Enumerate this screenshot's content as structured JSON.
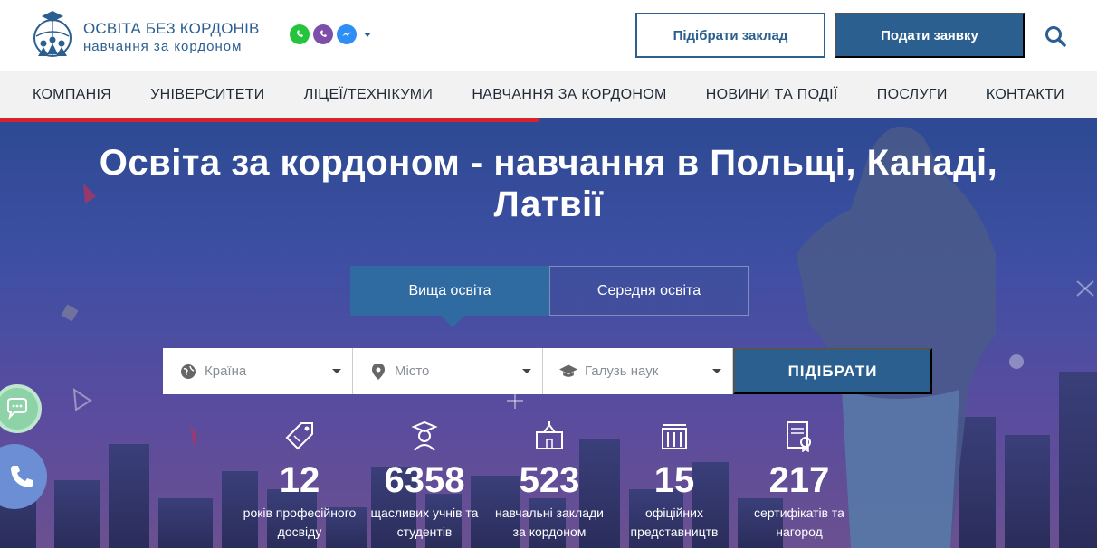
{
  "header": {
    "logo_title": "ОСВІТА БЕЗ КОРДОНІВ",
    "logo_subtitle": "навчання за кордоном",
    "btn_pick_school": "Підібрати заклад",
    "btn_apply": "Подати заявку"
  },
  "nav": {
    "items": [
      "КОМПАНІЯ",
      "УНІВЕРСИТЕТИ",
      "ЛІЦЕЇ/ТЕХНІКУМИ",
      "НАВЧАННЯ ЗА КОРДОНОМ",
      "НОВИНИ ТА ПОДІЇ",
      "ПОСЛУГИ",
      "КОНТАКТИ"
    ]
  },
  "hero": {
    "title_line1": "Освіта за кордоном - навчання в Польщі, Канаді,",
    "title_line2": "Латвії",
    "tabs": [
      "Вища освіта",
      "Середня освіта"
    ],
    "filters": {
      "country": "Країна",
      "city": "Місто",
      "field": "Галузь наук",
      "submit": "ПІДІБРАТИ"
    },
    "stats": [
      {
        "number": "12",
        "label_line1": "років професійного",
        "label_line2": "досвіду"
      },
      {
        "number": "6358",
        "label_line1": "щасливих учнів та",
        "label_line2": "студентів"
      },
      {
        "number": "523",
        "label_line1": "навчальні заклади",
        "label_line2": "за кордоном"
      },
      {
        "number": "15",
        "label_line1": "офіційних",
        "label_line2": "представництв"
      },
      {
        "number": "217",
        "label_line1": "сертифікатів та",
        "label_line2": "нагород"
      }
    ]
  },
  "colors": {
    "brand": "#2b5f8f",
    "accent_red": "#d8232a",
    "tab_active": "#2f6aa0"
  },
  "icons": {
    "search": "search-icon",
    "whatsapp": "whatsapp-icon",
    "viber": "viber-icon",
    "messenger": "messenger-icon",
    "globe": "globe-icon",
    "pin": "map-pin-icon",
    "cap": "graduation-cap-icon",
    "chat": "chat-icon",
    "phone": "phone-icon"
  }
}
